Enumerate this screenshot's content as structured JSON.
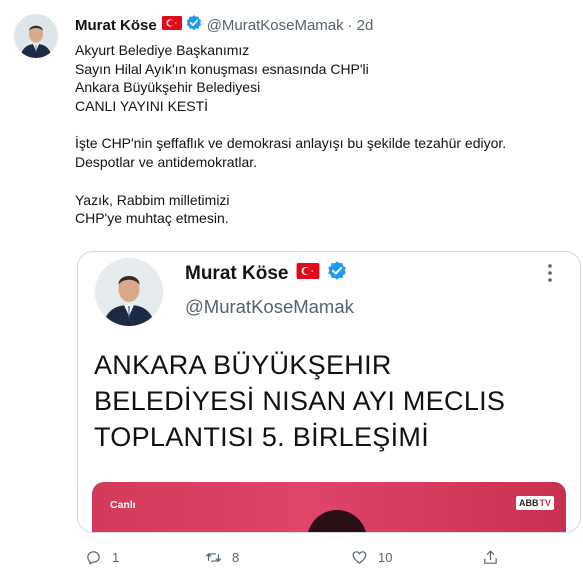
{
  "tweet": {
    "author_name": "Murat Köse",
    "author_handle": "@MuratKoseMamak",
    "separator": "·",
    "time": "2d",
    "text_lines": [
      "Akyurt Belediye Başkanımız",
      "Sayın Hilal Ayık'ın konuşması esnasında CHP'li",
      "Ankara Büyükşehir Belediyesi",
      "CANLI YAYINI KESTİ",
      "",
      "İşte CHP'nin şeffaflık ve demokrasi anlayışı bu şekilde tezahür ediyor.",
      "Despotlar ve antidemokratlar.",
      "",
      "Yazık, Rabbim milletimizi",
      "CHP'ye muhtaç etmesin."
    ]
  },
  "quote": {
    "author_name": "Murat Köse",
    "author_handle": "@MuratKoseMamak",
    "title_lines": [
      "ANKARA BÜYÜKŞEHIR",
      "BELEDİYESİ NISAN AYI MECLIS",
      "TOPLANTISI 5. BİRLEŞİMİ"
    ],
    "video_label": "Canlı",
    "video_logo_text": "ABB",
    "video_logo_suffix": "TV"
  },
  "actions": {
    "reply_count": "1",
    "retweet_count": "8",
    "like_count": "10",
    "share_count": ""
  },
  "icons": {
    "verified": "verified-badge-icon",
    "flag": "turkey-flag-icon",
    "reply": "reply-icon",
    "retweet": "retweet-icon",
    "like": "heart-icon",
    "share": "share-icon",
    "more": "more-vertical-icon"
  },
  "colors": {
    "verified_blue": "#1d9bf0",
    "secondary_text": "#536471",
    "flag_red": "#e30a17",
    "video_red": "#d4395a"
  }
}
